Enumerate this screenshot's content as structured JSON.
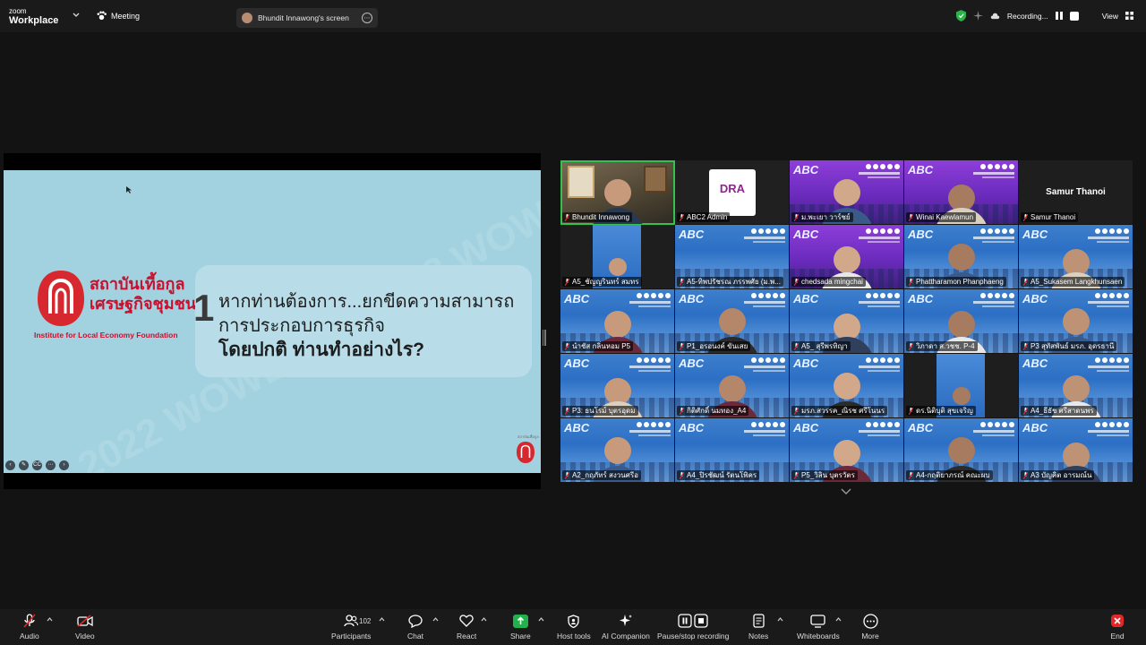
{
  "app": {
    "logo_line1": "zoom",
    "logo_line2": "Workplace",
    "meeting_label": "Meeting"
  },
  "top": {
    "screen_share_label": "Bhundit Innawong's screen",
    "recording_label": "Recording...",
    "view_label": "View"
  },
  "slide": {
    "org_name_th_line1": "สถาบันเที้อกูล",
    "org_name_th_line2": "เศรษฐกิจชุมชน",
    "org_name_en": "Institute for Local Economy Foundation",
    "question_number": "1",
    "question_line1": "หากท่านต้องการ...ยกขีดความสามารถ",
    "question_line2": "การประกอบการธุรกิจ",
    "question_line3": "โดยปกติ ท่านทำอย่างไร?",
    "watermark_1": "© 2022 WOWLE PMUA",
    "watermark_2": "© 2022 WOWLE PMUA",
    "mini_logo_label": "สถาบันเที้อกูล"
  },
  "slide_controls": [
    {
      "name": "prev-slide-icon",
      "glyph": "‹"
    },
    {
      "name": "pen-icon",
      "glyph": "✎"
    },
    {
      "name": "cc-icon",
      "glyph": "CC"
    },
    {
      "name": "more-dots-icon",
      "glyph": "⋯"
    },
    {
      "name": "next-slide-icon",
      "glyph": "›"
    }
  ],
  "participants": [
    {
      "name": "Bhundit Innawong",
      "bg": "office",
      "active": true
    },
    {
      "name": "ABC2 Admin",
      "bg": "dra"
    },
    {
      "name": "ม.พะเยา วาร์ชย์",
      "bg": "purple"
    },
    {
      "name": "Winai Kaewlamun",
      "bg": "purple"
    },
    {
      "name": "Samur Thanoi",
      "bg": "name",
      "big_name": "Samur Thanoi"
    },
    {
      "name": "A5_ชัญญรินทร์ สมทร",
      "bg": "narrow"
    },
    {
      "name": "A5-ทิพปรัชรณ ภรรพศัย (ม.พ...",
      "bg": "blue-empty"
    },
    {
      "name": "chedsada mingchai",
      "bg": "purple"
    },
    {
      "name": "Phattharamon Phanphaeng",
      "bg": "blue"
    },
    {
      "name": "A5_Sukasem Langkhunsaen",
      "bg": "blue"
    },
    {
      "name": "นำชัส กลิ่นหอม P5",
      "bg": "blue"
    },
    {
      "name": "P1_อรอนงค์ ขันเสย",
      "bg": "blue"
    },
    {
      "name": "A5_ สุรีพรทิญา",
      "bg": "blue"
    },
    {
      "name": "วิภาดา ส.วชช. P-4",
      "bg": "blue"
    },
    {
      "name": "P3 สุทัสพันธ์ มรภ. อุดรธานี",
      "bg": "blue"
    },
    {
      "name": "P3: ธนโรม์ บุตรอุดม",
      "bg": "blue"
    },
    {
      "name": "กิติศักดิ์ นมทอง_A4",
      "bg": "blue"
    },
    {
      "name": "มรภ.สวรรค_ณิรช ศรีโนนร",
      "bg": "blue"
    },
    {
      "name": "ดร.นิติบุติ สุขเจริญ",
      "bg": "narrow"
    },
    {
      "name": "A4_ธีธัช ศรีสาดนพร",
      "bg": "blue"
    },
    {
      "name": "A2_กฤภัทร์ สงวนศรีอ",
      "bg": "blue"
    },
    {
      "name": "A4_ปิรชัฒน์ รัตนโพิคร",
      "bg": "blue-empty"
    },
    {
      "name": "P5_วิลิน บุตรวัตร",
      "bg": "blue"
    },
    {
      "name": "A4-กฤติยาภรณ์ คณะผบ",
      "bg": "blue"
    },
    {
      "name": "A3 บัญคิต อารมณ์น",
      "bg": "blue"
    }
  ],
  "toolbar": {
    "audio": "Audio",
    "video": "Video",
    "participants": "Participants",
    "participants_count": "102",
    "chat": "Chat",
    "react": "React",
    "share": "Share",
    "host_tools": "Host tools",
    "ai_companion": "AI Companion",
    "pause_recording": "Pause/stop recording",
    "notes": "Notes",
    "whiteboards": "Whiteboards",
    "more": "More",
    "end": "End"
  },
  "colors": {
    "active_border": "#33c24f",
    "share_green": "#22b14c",
    "end_red": "#e02828",
    "brand_red": "#c8102e",
    "slide_bg": "#a2d2e0"
  }
}
